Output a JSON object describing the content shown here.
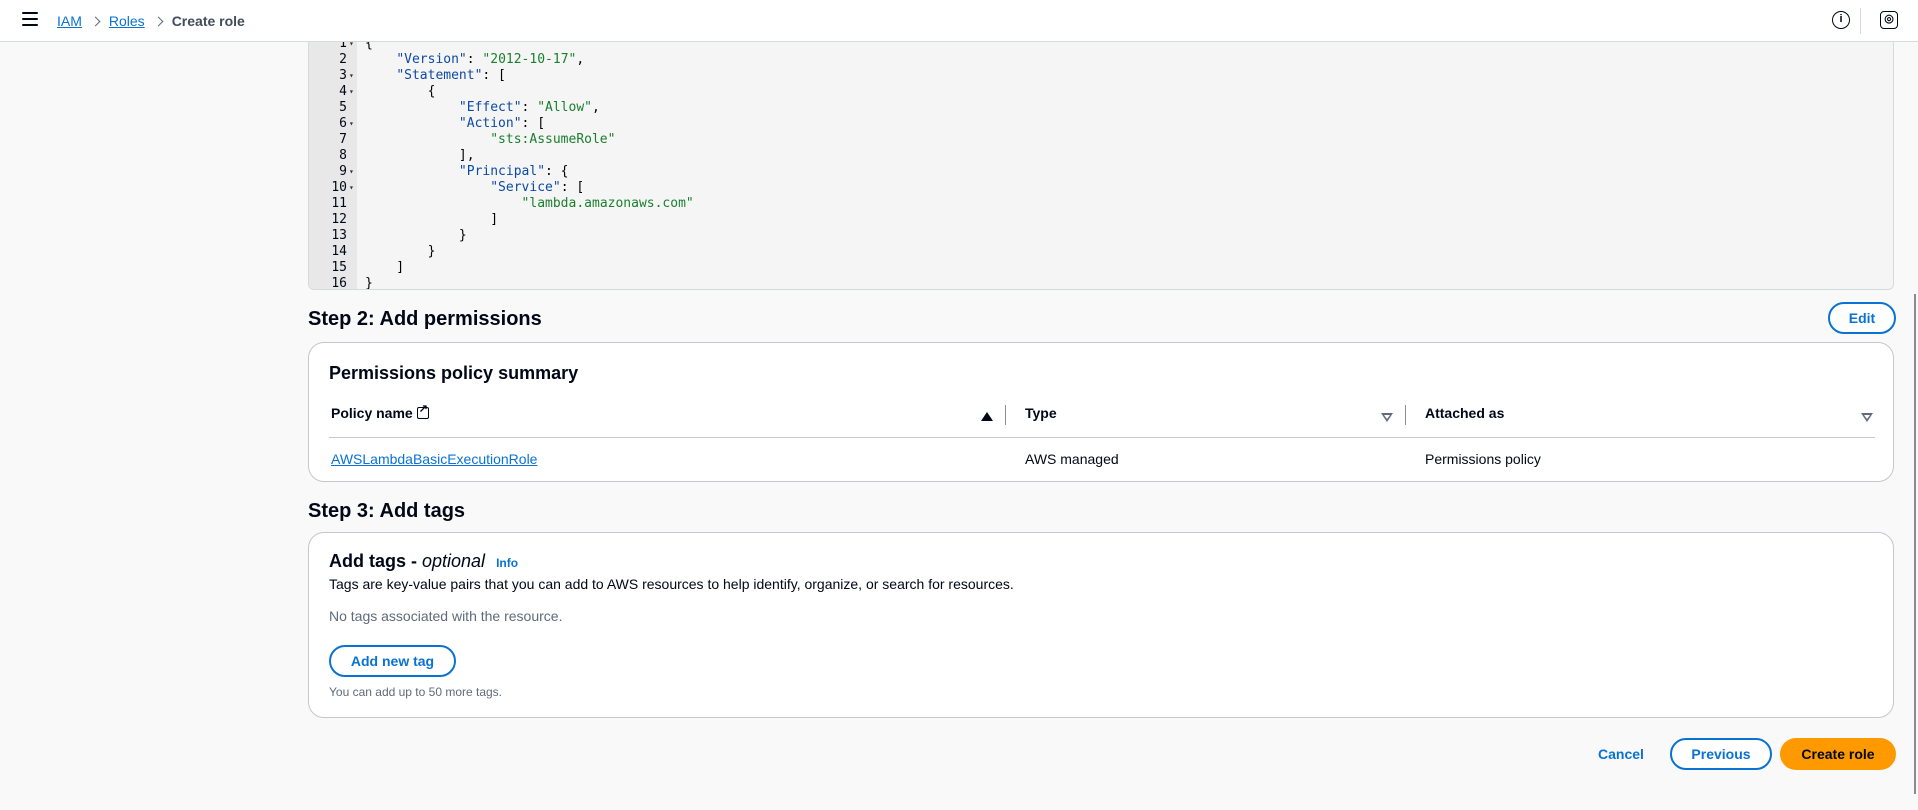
{
  "header": {
    "breadcrumb": [
      "IAM",
      "Roles",
      "Create role"
    ]
  },
  "editor": {
    "lines": [
      {
        "n": "1",
        "fold": "▾",
        "text": "{"
      },
      {
        "n": "2",
        "fold": "",
        "text": "    \"Version\": \"2012-10-17\","
      },
      {
        "n": "3",
        "fold": "▾",
        "text": "    \"Statement\": ["
      },
      {
        "n": "4",
        "fold": "▾",
        "text": "        {"
      },
      {
        "n": "5",
        "fold": "",
        "text": "            \"Effect\": \"Allow\","
      },
      {
        "n": "6",
        "fold": "▾",
        "text": "            \"Action\": ["
      },
      {
        "n": "7",
        "fold": "",
        "text": "                \"sts:AssumeRole\""
      },
      {
        "n": "8",
        "fold": "",
        "text": "            ],"
      },
      {
        "n": "9",
        "fold": "▾",
        "text": "            \"Principal\": {"
      },
      {
        "n": "10",
        "fold": "▾",
        "text": "                \"Service\": ["
      },
      {
        "n": "11",
        "fold": "",
        "text": "                    \"lambda.amazonaws.com\""
      },
      {
        "n": "12",
        "fold": "",
        "text": "                ]"
      },
      {
        "n": "13",
        "fold": "",
        "text": "            }"
      },
      {
        "n": "14",
        "fold": "",
        "text": "        }"
      },
      {
        "n": "15",
        "fold": "",
        "text": "    ]"
      },
      {
        "n": "16",
        "fold": "",
        "text": "}"
      }
    ]
  },
  "step2": {
    "title": "Step 2: Add permissions",
    "edit_label": "Edit",
    "card_title": "Permissions policy summary",
    "columns": [
      "Policy name",
      "Type",
      "Attached as"
    ],
    "rows": [
      {
        "policy_name": "AWSLambdaBasicExecutionRole",
        "type": "AWS managed",
        "attached_as": "Permissions policy"
      }
    ]
  },
  "step3": {
    "title": "Step 3: Add tags",
    "card_title": "Add tags - ",
    "card_title_italic": "optional",
    "info_label": "Info",
    "description": "Tags are key-value pairs that you can add to AWS resources to help identify, organize, or search for resources.",
    "empty_text": "No tags associated with the resource.",
    "add_tag_label": "Add new tag",
    "limit_text": "You can add up to 50 more tags."
  },
  "footer": {
    "cancel_label": "Cancel",
    "previous_label": "Previous",
    "create_label": "Create role"
  },
  "colors": {
    "link": "#0972d3",
    "primary_button": "#ff9900",
    "code_string": "#1a7f2e",
    "code_key": "#0d4aa6"
  }
}
